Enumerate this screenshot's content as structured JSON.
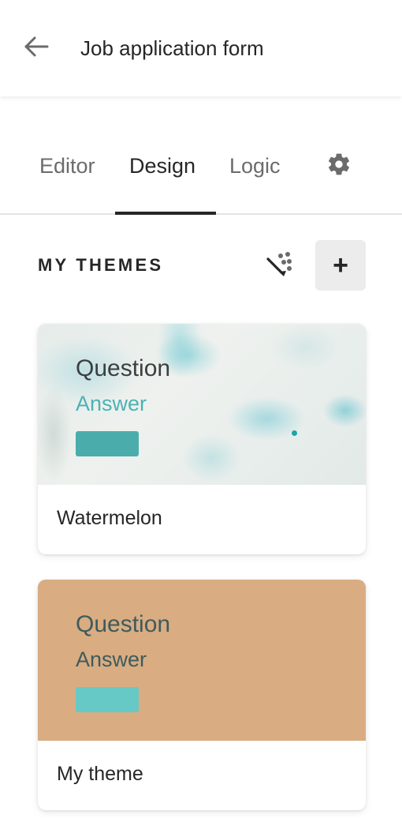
{
  "header": {
    "back_icon": "arrow-left-icon",
    "title": "Job application form"
  },
  "tabs": {
    "items": [
      {
        "label": "Editor",
        "active": false
      },
      {
        "label": "Design",
        "active": true
      },
      {
        "label": "Logic",
        "active": false
      }
    ],
    "settings_icon": "gear-icon"
  },
  "themes": {
    "heading": "MY THEMES",
    "gallery_icon": "theme-gallery-icon",
    "add_label": "+",
    "cards": [
      {
        "name": "Watermelon",
        "preview": {
          "question": "Question",
          "answer": "Answer",
          "question_color": "#3b3f3f",
          "answer_color": "#4bb3b3",
          "button_color": "#4aadab",
          "background": "marble"
        }
      },
      {
        "name": "My theme",
        "preview": {
          "question": "Question",
          "answer": "Answer",
          "question_color": "#3f5b5c",
          "answer_color": "#3f5b5c",
          "button_color": "#66c9c5",
          "background": "#d9ac82"
        }
      }
    ]
  },
  "colors": {
    "text_primary": "#262627",
    "text_secondary": "#6b6b6b",
    "divider": "#e4e4e4",
    "add_button_bg": "#ececec"
  }
}
